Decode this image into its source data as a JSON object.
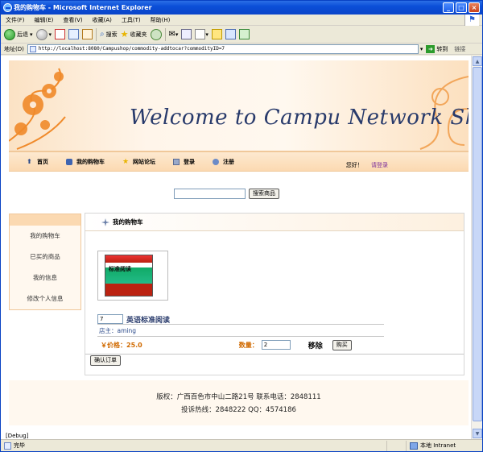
{
  "window": {
    "title": "我的购物车 - Microsoft Internet Explorer",
    "min_btn": "_",
    "max_btn": "□",
    "close_btn": "×"
  },
  "menubar": {
    "items": [
      "文件(F)",
      "编辑(E)",
      "查看(V)",
      "收藏(A)",
      "工具(T)",
      "帮助(H)"
    ]
  },
  "toolbar": {
    "back_label": "后退",
    "search_label": "搜索",
    "favorites_label": "收藏夹"
  },
  "addressbar": {
    "label": "地址(D)",
    "url": "http://localhost:8080/Campushop/commodity-addtocar?commodityID=7",
    "go_label": "转到",
    "links_label": "链接"
  },
  "banner": {
    "title": "Welcome to Campu Network Shops"
  },
  "nav": {
    "items": [
      "首页",
      "我的购物车",
      "网站论坛",
      "登录",
      "注册"
    ],
    "greeting": "您好！",
    "login_prompt": "请登录"
  },
  "search": {
    "button_label": "搜索商品",
    "value": ""
  },
  "leftnav": {
    "items": [
      "我的购物车",
      "已买的商品",
      "我的信息",
      "修改个人信息"
    ]
  },
  "cart": {
    "heading": "我的购物车",
    "book_title": "标准阅读",
    "item": {
      "id_value": "7",
      "name": "英语标准阅读",
      "owner": "店主：aming",
      "price_label": "￥价格：",
      "price": "25.0",
      "qty_label": "数量：",
      "qty_value": "2",
      "remove_label": "移除",
      "buy_label": "购买"
    },
    "confirm_label": "确认订单"
  },
  "footer": {
    "line1": "版权：广西百色市中山二路21号  联系电话：2848111",
    "line2": "投诉热线：2848222  QQ：4574186"
  },
  "debug": "[Debug]",
  "statusbar": {
    "status": "完毕",
    "zone": "本地 Intranet"
  },
  "colors": {
    "accent": "#d06a00",
    "brand": "#283a6b",
    "link": "#7a2a9a",
    "xp_blue": "#0b4fd8"
  }
}
